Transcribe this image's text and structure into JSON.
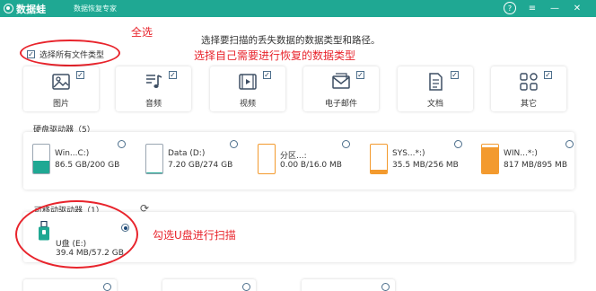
{
  "titlebar": {
    "app_name": "数据蛙",
    "subtitle": "数据恢复专家",
    "help": "?",
    "menu": "≡",
    "minimize": "—",
    "close": "✕"
  },
  "select_all": {
    "label": "选择所有文件类型",
    "checked": true
  },
  "instruction": "选择要扫描的丢失数据的数据类型和路径。",
  "annotations": {
    "select_all": "全选",
    "choose_types": "选择自己需要进行恢复的数据类型",
    "choose_usb": "勾选U盘进行扫描"
  },
  "file_types": [
    {
      "label": "图片",
      "icon": "image-icon",
      "checked": true
    },
    {
      "label": "音频",
      "icon": "music-icon",
      "checked": true
    },
    {
      "label": "视频",
      "icon": "video-icon",
      "checked": true
    },
    {
      "label": "电子邮件",
      "icon": "mail-icon",
      "checked": true
    },
    {
      "label": "文档",
      "icon": "document-icon",
      "checked": true
    },
    {
      "label": "其它",
      "icon": "apps-icon",
      "checked": true
    }
  ],
  "hard_drives": {
    "title": "硬盘驱动器（5）",
    "drives": [
      {
        "name": "Win...C:)",
        "size": "86.5 GB/200 GB",
        "used_fraction": 0.43,
        "fill_color": "#1fa893"
      },
      {
        "name": "Data (D:)",
        "size": "7.20 GB/274 GB",
        "used_fraction": 0.03,
        "fill_color": "#1fa893"
      },
      {
        "name": "分区...:",
        "size": "0.00  B/16.0 MB",
        "used_fraction": 0.0,
        "fill_color": "#f39a2e"
      },
      {
        "name": "SYS...*:)",
        "size": "35.5 MB/256 MB",
        "used_fraction": 0.14,
        "fill_color": "#f39a2e"
      },
      {
        "name": "WIN...*:)",
        "size": "817 MB/895 MB",
        "used_fraction": 0.91,
        "fill_color": "#f39a2e"
      }
    ]
  },
  "removable": {
    "title": "可移动驱动器（1）",
    "drive": {
      "name": "U盘 (E:)",
      "size": "39.4 MB/57.2 GB",
      "selected": true
    }
  },
  "colors": {
    "brand": "#1fa893",
    "annotation": "#e8242c"
  }
}
